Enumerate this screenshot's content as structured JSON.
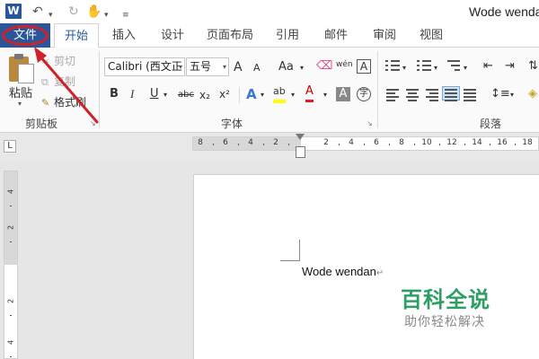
{
  "window": {
    "title": "Wode wendan"
  },
  "quick_access": {
    "app_icon": "W",
    "undo_icon": "undo-icon",
    "redo_icon": "redo-icon",
    "touch_icon": "touch-mode-icon",
    "customize_icon": "customize-icon"
  },
  "tabs": [
    {
      "label": "文件"
    },
    {
      "label": "开始"
    },
    {
      "label": "插入"
    },
    {
      "label": "设计"
    },
    {
      "label": "页面布局"
    },
    {
      "label": "引用"
    },
    {
      "label": "邮件"
    },
    {
      "label": "审阅"
    },
    {
      "label": "视图"
    }
  ],
  "clipboard": {
    "paste_label": "粘贴",
    "cut_label": "剪切",
    "copy_label": "复制",
    "format_painter_label": "格式刷",
    "group_label": "剪贴板"
  },
  "font": {
    "family": "Calibri (西文正",
    "size": "五号",
    "group_label": "字体",
    "grow": "A",
    "shrink": "A",
    "case": "Aa",
    "phonetic": "wén",
    "border_char": "A",
    "bold": "B",
    "italic": "I",
    "underline": "U",
    "strike": "abc",
    "subscript": "x₂",
    "superscript": "x²",
    "text_effect": "A",
    "highlight": "ab",
    "font_color": "A",
    "shading": "A",
    "enclose": "字"
  },
  "paragraph": {
    "group_label": "段落"
  },
  "colors": {
    "accent": "#2b579a",
    "annotation": "#d0202a",
    "watermark": "#2f9e63"
  },
  "ruler": {
    "corner": "L",
    "h_ticks": [
      "8",
      "6",
      "4",
      "2",
      "2",
      "4",
      "6",
      "8",
      "10",
      "12",
      "14",
      "16",
      "18"
    ],
    "v_ticks": [
      "4",
      "2",
      "2",
      "4"
    ]
  },
  "document": {
    "text": "Wode wendan",
    "paragraph_mark": "↵"
  },
  "watermark": {
    "title": "百科全说",
    "subtitle": "助你轻松解决"
  }
}
